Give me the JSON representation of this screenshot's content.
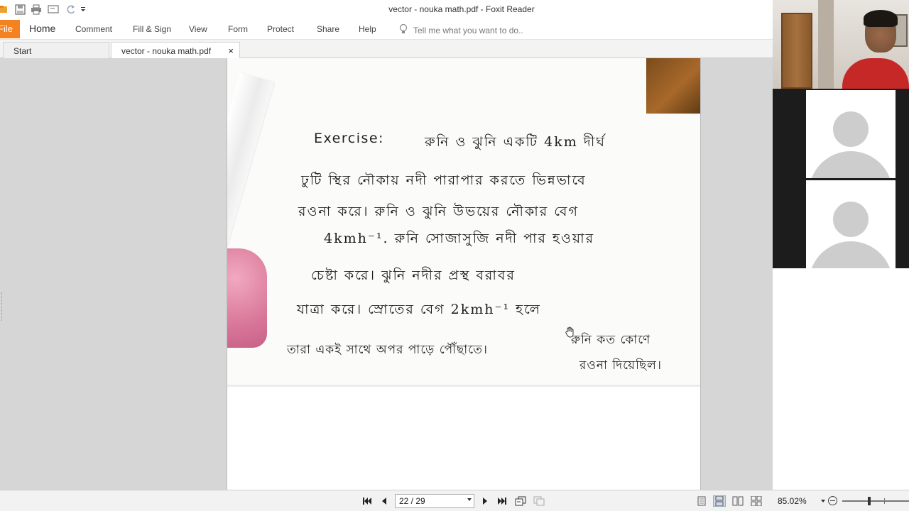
{
  "window": {
    "title": "vector - nouka math.pdf - Foxit Reader"
  },
  "ribbon": {
    "file_label": "File",
    "items": [
      "Home",
      "Comment",
      "Fill & Sign",
      "View",
      "Form",
      "Protect",
      "Share",
      "Help"
    ],
    "active": "Home",
    "tell_me_placeholder": "Tell me what you want to do.."
  },
  "tabs": [
    {
      "label": "Start"
    },
    {
      "label": "vector - nouka math.pdf",
      "close": "×"
    }
  ],
  "document": {
    "handwriting": {
      "line1_prefix": "Exercise:",
      "line1": "রুনি ও ঝুনি একটি 4km দীর্ঘ",
      "line2": "ঢুটি স্থির নৌকায় নদী পারাপার করতে ভিন্নভাবে",
      "line3": "রওনা করে। রুনি ও ঝুনি উভয়ের নৌকার বেগ",
      "line4": "4kmh⁻¹. রুনি সোজাসুজি নদী পার হওয়ার",
      "line5": "চেষ্টা করে। ঝুনি নদীর প্রস্থ বরাবর",
      "line6": "যাত্রা করে। স্রোতের বেগ 2kmh⁻¹ হলে",
      "line7a": "তারা একই সাথে অপর পাড়ে পৌঁছাতে।",
      "line7b": "রুনি কত কোণে",
      "line8": "রওনা দিয়েছিল।"
    }
  },
  "statusbar": {
    "page_indicator": "22 / 29",
    "zoom": "85.02%"
  },
  "colors": {
    "accent": "#f58220",
    "background": "#d6d6d6"
  }
}
